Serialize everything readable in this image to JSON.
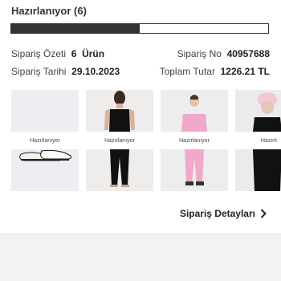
{
  "order": {
    "status_title": "Hazırlanıyor (6)",
    "progress": 0.5,
    "summary_label": "Sipariş Özeti",
    "summary_count": "6",
    "summary_unit": "Ürün",
    "order_no_label": "Sipariş No",
    "order_no": "40957688",
    "date_label": "Sipariş Tarihi",
    "date": "29.10.2023",
    "total_label": "Toplam Tutar",
    "total": "1226.21 TL"
  },
  "products": [
    {
      "status": "Hazırlanıyor",
      "image": "sneakers"
    },
    {
      "status": "Hazırlanıyor",
      "image": "black-top-outfit"
    },
    {
      "status": "Hazırlanıyor",
      "image": "pink-tracksuit"
    },
    {
      "status": "Hazırlı",
      "image": "black-jacket-pink-beanie"
    }
  ],
  "footer": {
    "details_label": "Sipariş Detayları",
    "chevron_icon": "chevron-right-icon"
  }
}
